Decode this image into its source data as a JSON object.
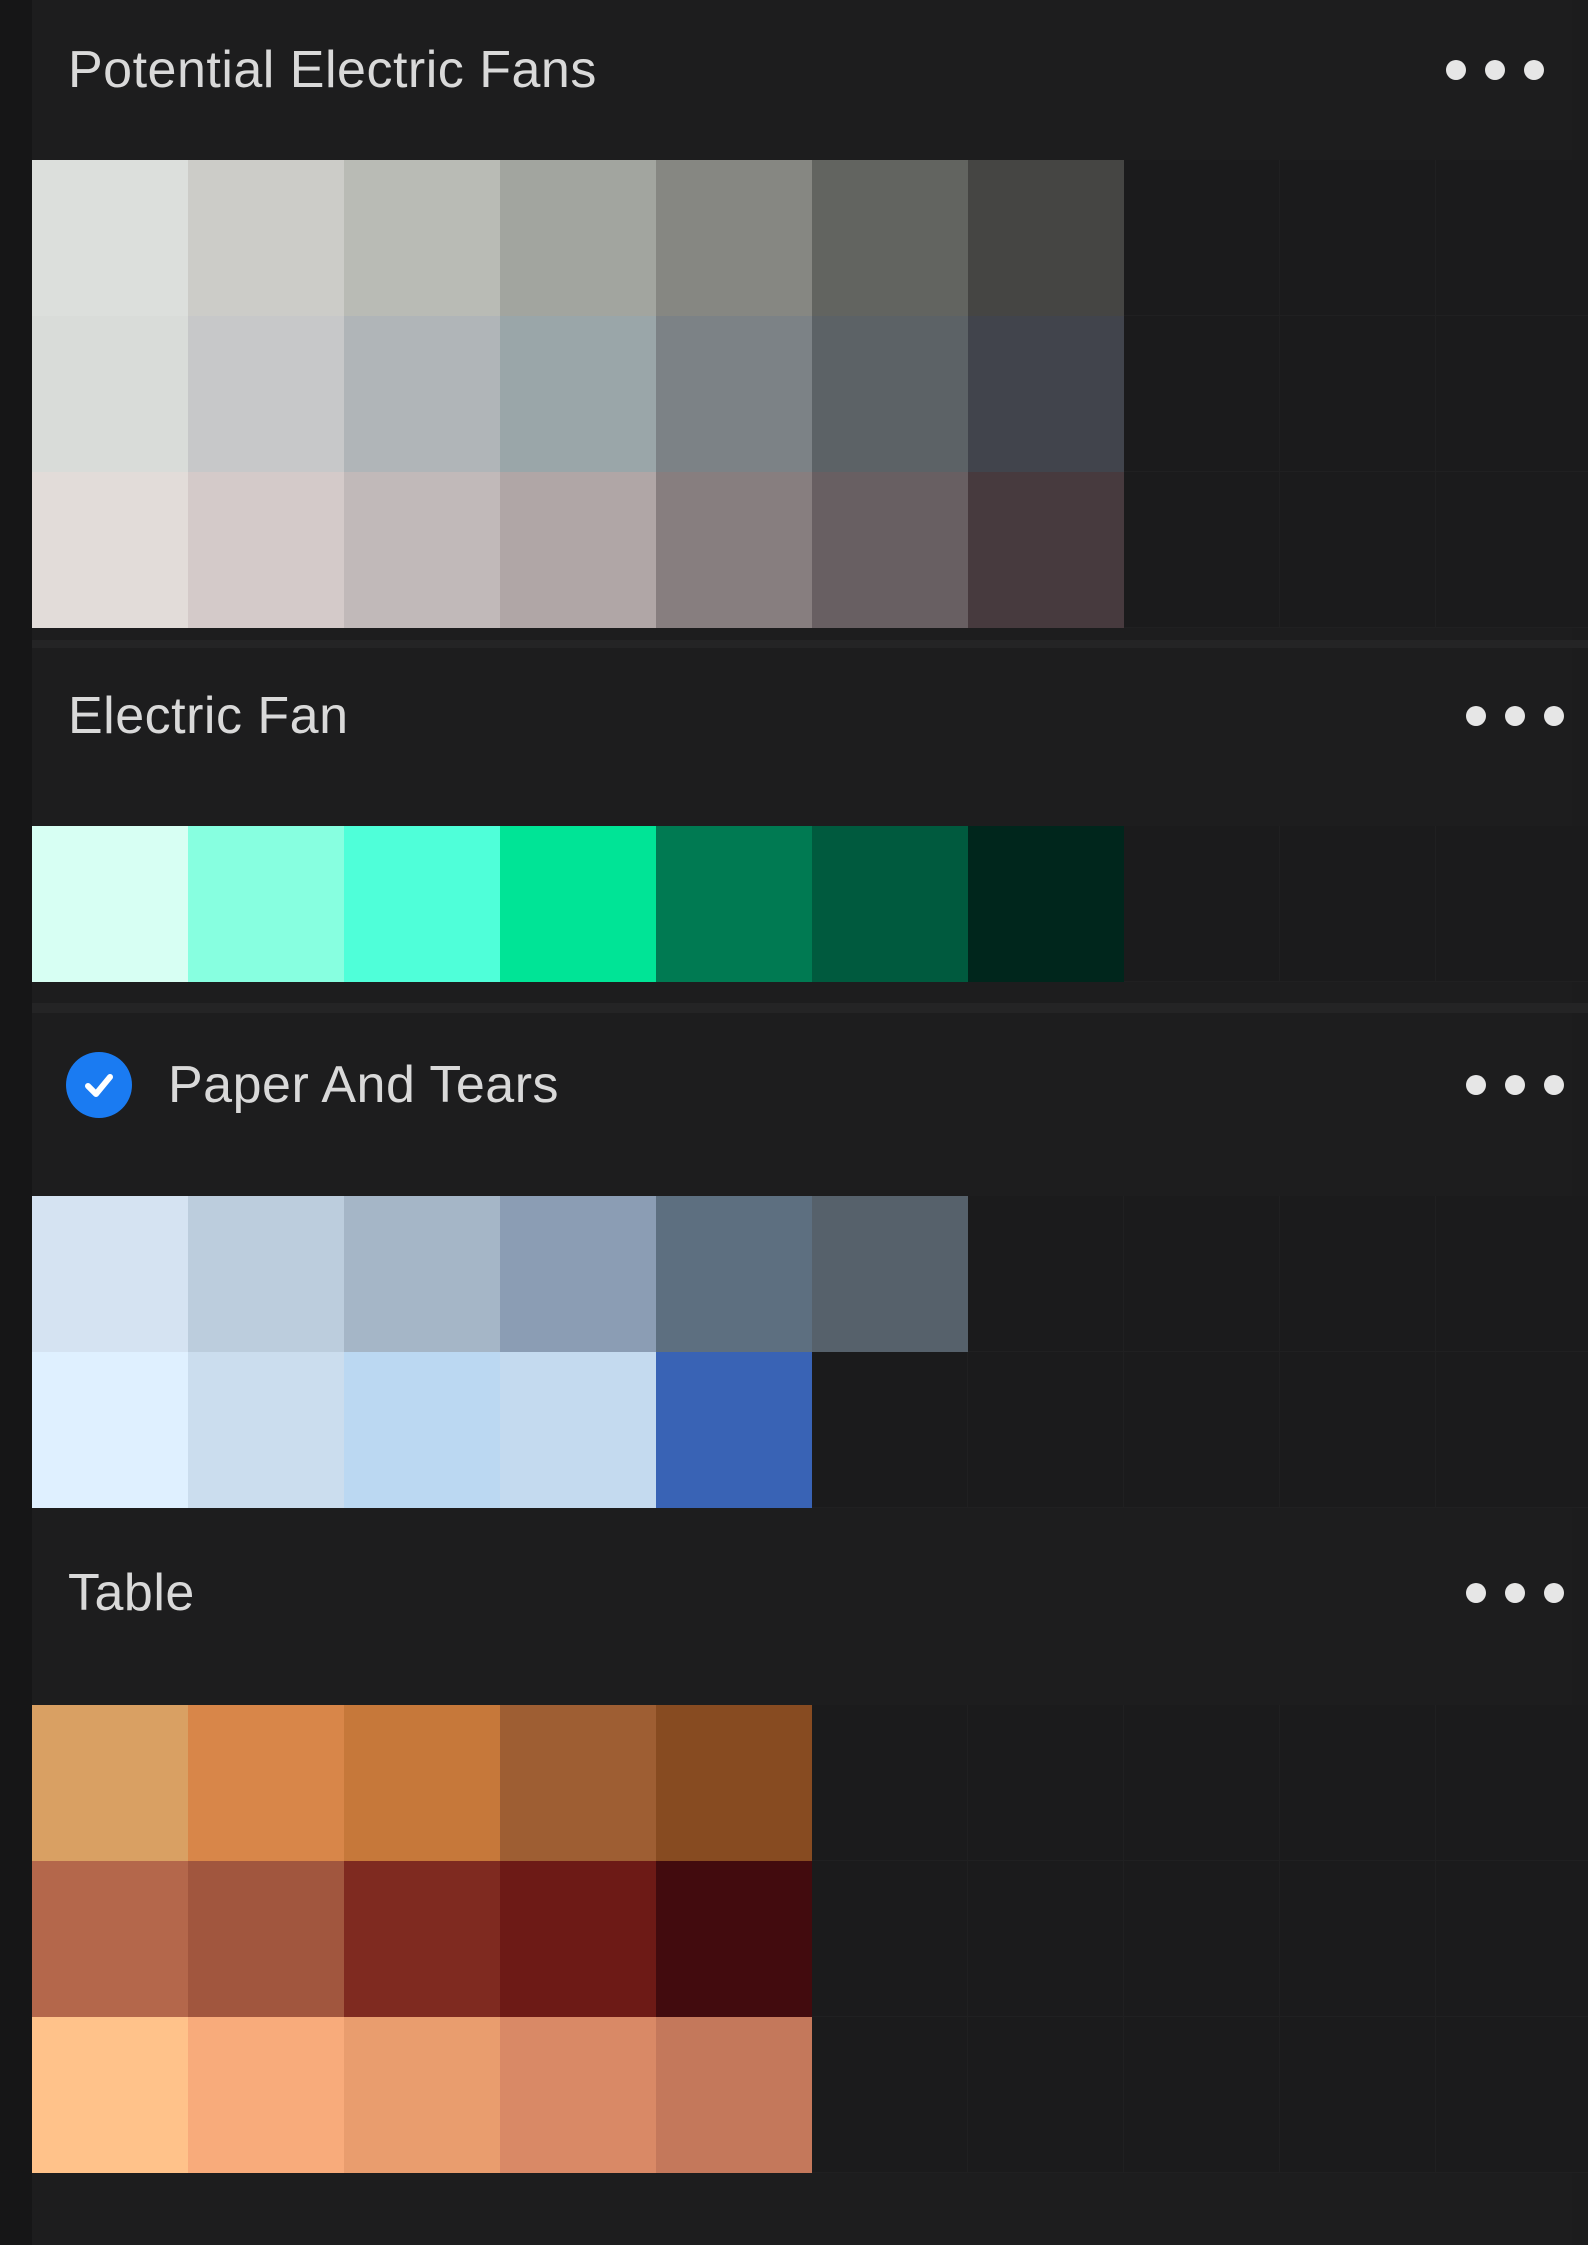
{
  "palettes": [
    {
      "title": "Potential Electric Fans",
      "selected": false,
      "more_icon": "more-horizontal-icon",
      "rows": [
        [
          "#dcdfdc",
          "#ccccc8",
          "#b9bbb5",
          "#a2a59f",
          "#868782",
          "#626460",
          "#454543",
          "",
          "",
          ""
        ],
        [
          "#d9dcd9",
          "#c7c8c9",
          "#b0b5b8",
          "#9aa6a9",
          "#7c8286",
          "#5c6266",
          "#41444c",
          "",
          "",
          ""
        ],
        [
          "#e2dcd9",
          "#d4cac9",
          "#c1b9b9",
          "#b0a6a6",
          "#877e7f",
          "#685f62",
          "#473a3e",
          "",
          "",
          ""
        ]
      ]
    },
    {
      "title": "Electric Fan",
      "selected": false,
      "more_icon": "more-horizontal-icon",
      "rows": [
        [
          "#d7fff3",
          "#87ffe0",
          "#4fffd9",
          "#00e496",
          "#007a52",
          "#005a3e",
          "#00261c",
          "",
          "",
          ""
        ]
      ]
    },
    {
      "title": "Paper And Tears",
      "selected": true,
      "check_icon": "checkmark-circle-icon",
      "more_icon": "more-horizontal-icon",
      "rows": [
        [
          "#d5e3f2",
          "#bccddd",
          "#a5b6c7",
          "#8b9db4",
          "#5d6f80",
          "#56616b",
          "",
          "",
          "",
          ""
        ],
        [
          "#dff0ff",
          "#cbddee",
          "#bbd8f2",
          "#c4daef",
          "#3963b5",
          "",
          "",
          "",
          "",
          ""
        ]
      ]
    },
    {
      "title": "Table",
      "selected": false,
      "more_icon": "more-horizontal-icon",
      "rows": [
        [
          "#d9a063",
          "#d88649",
          "#c6783a",
          "#9e5e33",
          "#874b21",
          "",
          "",
          "",
          "",
          ""
        ],
        [
          "#b4674b",
          "#a1563e",
          "#7f2a20",
          "#6d1a16",
          "#420b0e",
          "",
          "",
          "",
          "",
          ""
        ],
        [
          "#ffc28a",
          "#f8ab7b",
          "#e99d6e",
          "#d98966",
          "#c4785b",
          "",
          "",
          "",
          "",
          ""
        ]
      ]
    }
  ]
}
